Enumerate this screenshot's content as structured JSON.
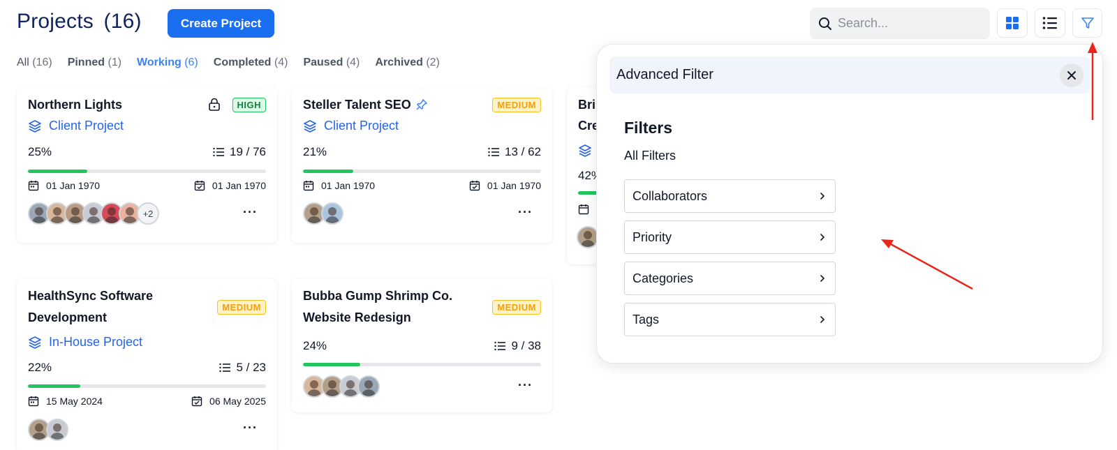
{
  "header": {
    "title": "Projects",
    "count": "(16)",
    "create_label": "Create Project",
    "search_placeholder": "Search..."
  },
  "tabs": [
    {
      "label": "All",
      "count": "(16)"
    },
    {
      "label": "Pinned",
      "count": "(1)"
    },
    {
      "label": "Working",
      "count": "(6)"
    },
    {
      "label": "Completed",
      "count": "(4)"
    },
    {
      "label": "Paused",
      "count": "(4)"
    },
    {
      "label": "Archived",
      "count": "(2)"
    }
  ],
  "active_tab": "Working",
  "cards": [
    {
      "title_line1": "Northern Lights",
      "priority": "HIGH",
      "type": "Client Project",
      "progress": "25%",
      "progress_fraction": 0.25,
      "tasks": "19 / 76",
      "start": "01 Jan 1970",
      "end": "01 Jan 1970",
      "more_avatars": "+2"
    },
    {
      "title_line1": "Steller Talent SEO",
      "priority": "MEDIUM",
      "type": "Client Project",
      "progress": "21%",
      "progress_fraction": 0.21,
      "tasks": "13 / 62",
      "start": "01 Jan 1970",
      "end": "01 Jan 1970"
    },
    {
      "title_line1": "Bri",
      "title_line2": "Cre",
      "progress": "42%"
    },
    {
      "title_line1": "HealthSync Software",
      "title_line2": "Development",
      "priority": "MEDIUM",
      "type": "In-House Project",
      "progress": "22%",
      "progress_fraction": 0.22,
      "tasks": "5 / 23",
      "start": "15 May 2024",
      "end": "06 May 2025"
    },
    {
      "title_line1": "Bubba Gump Shrimp Co.",
      "title_line2": "Website Redesign",
      "priority": "MEDIUM",
      "progress": "24%",
      "progress_fraction": 0.24,
      "tasks": "9 / 38"
    }
  ],
  "filter_panel": {
    "title": "Advanced Filter",
    "heading": "Filters",
    "subheading": "All Filters",
    "items": [
      "Collaborators",
      "Priority",
      "Categories",
      "Tags"
    ]
  },
  "colors": {
    "primary": "#1a6ff0",
    "title_navy": "#0f2460",
    "progress_green": "#22c55e",
    "high_badge": "#15803d",
    "medium_badge": "#f59e0b",
    "annotation_arrow": "#e8261c"
  }
}
